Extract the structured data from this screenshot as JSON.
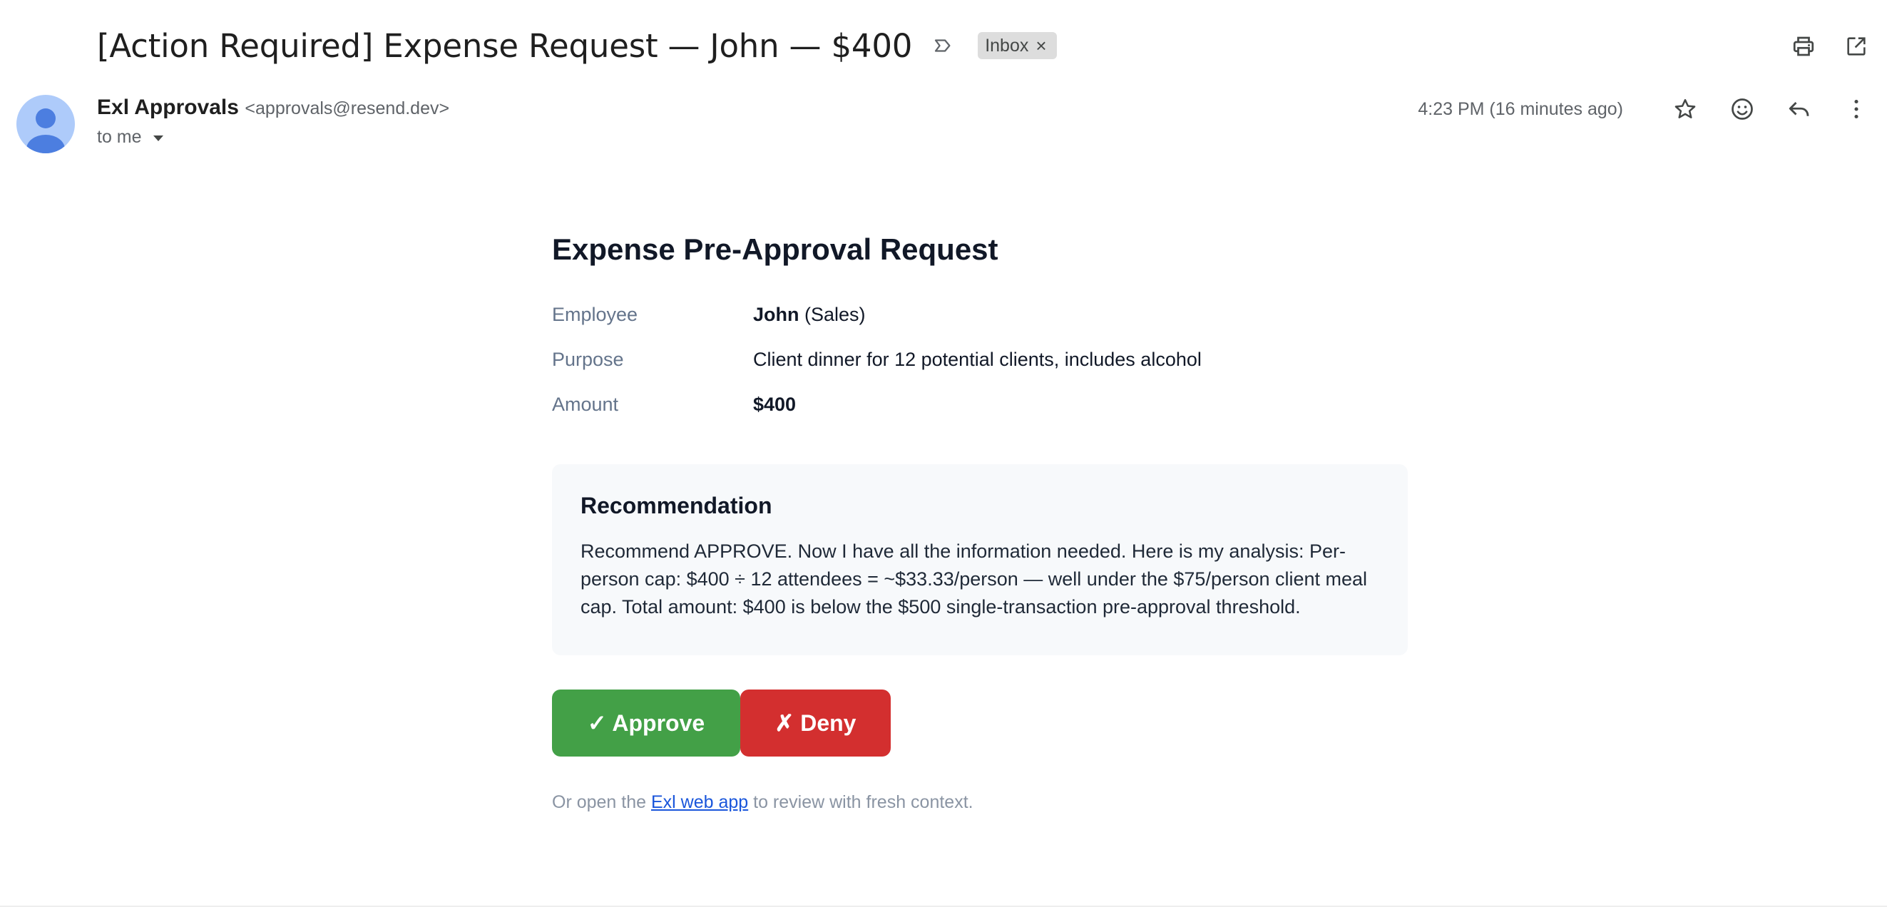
{
  "header": {
    "subject": "[Action Required] Expense Request — John — $400",
    "label_chip": "Inbox",
    "label_remove": "×"
  },
  "sender": {
    "name": "Exl Approvals",
    "email": "<approvals@resend.dev>",
    "recipient": "to me",
    "timestamp": "4:23 PM (16 minutes ago)"
  },
  "icons": {
    "top": [
      "print-icon",
      "open-in-new-window-icon"
    ],
    "meta": [
      "star-icon",
      "emoji-reaction-icon",
      "reply-icon",
      "more-options-icon"
    ],
    "label": "label-important-icon"
  },
  "email": {
    "title": "Expense Pre-Approval Request",
    "fields": [
      {
        "key": "Employee",
        "value_bold": "John",
        "value_rest": " (Sales)"
      },
      {
        "key": "Purpose",
        "value": "Client dinner for 12 potential clients, includes alcohol"
      },
      {
        "key": "Amount",
        "value_bold": "$400"
      }
    ],
    "recommendation": {
      "title": "Recommendation",
      "text": "Recommend APPROVE. Now I have all the information needed. Here is my analysis: Per-person cap: $400 ÷ 12 attendees = ~$33.33/person — well under the $75/person client meal cap. Total amount: $400 is below the $500 single-transaction pre-approval threshold."
    },
    "buttons": {
      "approve": "✓ Approve",
      "deny": "✗ Deny"
    },
    "footer": {
      "prefix": "Or open the ",
      "link": "Exl web app",
      "suffix": " to review with fresh context."
    }
  },
  "colors": {
    "approve": "#43a047",
    "deny": "#d32f2f",
    "link": "#1a56db",
    "avatar_bg": "#aecbfa",
    "avatar_fg": "#4c7ee0"
  }
}
